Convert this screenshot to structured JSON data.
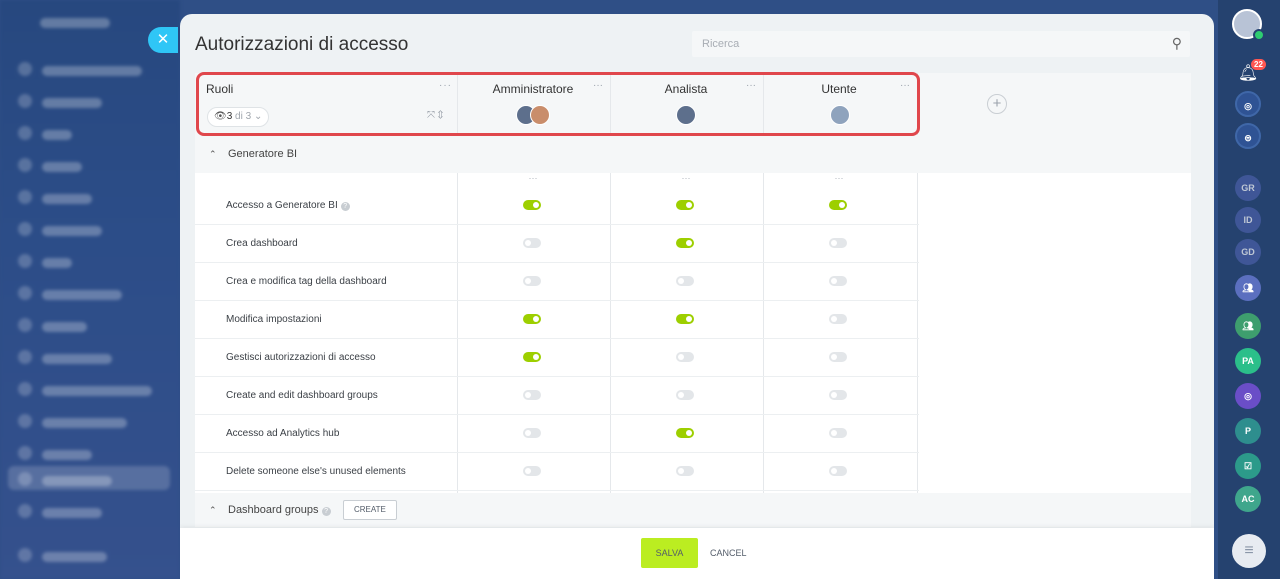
{
  "page": {
    "title": "Autorizzazioni di accesso"
  },
  "search": {
    "placeholder": "Ricerca"
  },
  "roles_header": {
    "label": "Ruoli",
    "counter_value": "3",
    "counter_total": "di 3",
    "menu": "···"
  },
  "roles": [
    {
      "name": "Amministratore",
      "menu": "···"
    },
    {
      "name": "Analista",
      "menu": "···"
    },
    {
      "name": "Utente",
      "menu": "···"
    }
  ],
  "sections": [
    {
      "label": "Generatore BI",
      "rows": [
        {
          "label": "Accesso a Generatore BI",
          "help": true,
          "values": [
            true,
            true,
            true
          ]
        },
        {
          "label": "Crea dashboard",
          "help": false,
          "values": [
            false,
            true,
            false
          ]
        },
        {
          "label": "Crea e modifica tag della dashboard",
          "help": false,
          "values": [
            false,
            false,
            false
          ]
        },
        {
          "label": "Modifica impostazioni",
          "help": false,
          "values": [
            true,
            true,
            false
          ]
        },
        {
          "label": "Gestisci autorizzazioni di accesso",
          "help": false,
          "values": [
            true,
            false,
            false
          ]
        },
        {
          "label": "Create and edit dashboard groups",
          "help": false,
          "values": [
            false,
            false,
            false
          ]
        },
        {
          "label": "Accesso ad Analytics hub",
          "help": false,
          "values": [
            false,
            true,
            false
          ]
        },
        {
          "label": "Delete someone else's unused elements",
          "help": false,
          "values": [
            false,
            false,
            false
          ]
        }
      ]
    },
    {
      "label": "Dashboard groups",
      "create_label": "CREATE"
    }
  ],
  "column_menu": "···",
  "footer": {
    "save_label": "SALVA",
    "cancel_label": "CANCEL"
  },
  "rail": {
    "notification_count": "22",
    "items": [
      "GR",
      "ID",
      "GD",
      "",
      "",
      "PA",
      "",
      "P",
      "",
      "AC"
    ]
  },
  "colors": {
    "toggle_on": "#9dcf00",
    "save": "#bbed21",
    "accent": "#2fc6f6",
    "highlight": "#e0474c"
  }
}
